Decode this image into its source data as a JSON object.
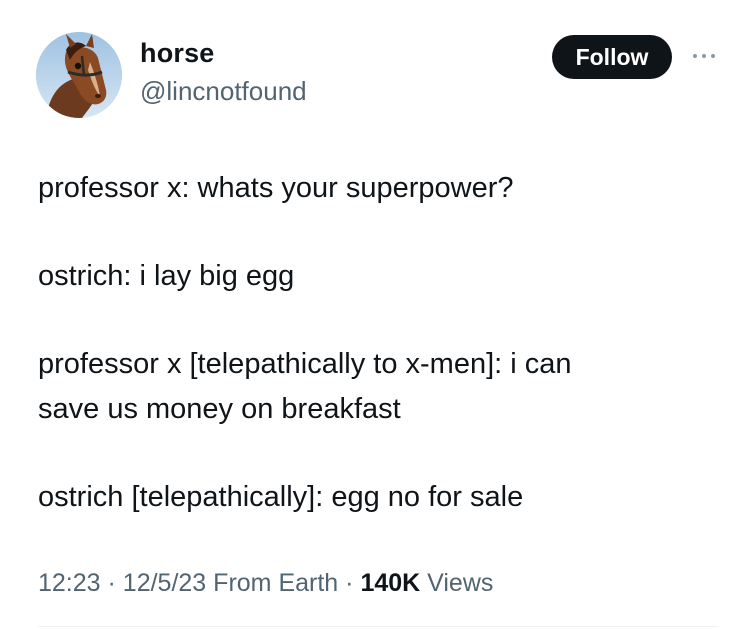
{
  "author": {
    "display_name": "horse",
    "handle": "@lincnotfound",
    "avatar_icon": "horse-avatar-icon"
  },
  "actions": {
    "follow_label": "Follow",
    "more_icon": "more-options-icon"
  },
  "tweet": {
    "lines": [
      "professor x: whats your superpower?",
      "ostrich: i lay big egg",
      "professor x [telepathically to x-men]: i can",
      "save us money on breakfast",
      "ostrich [telepathically]: egg no for sale"
    ]
  },
  "meta": {
    "time": "12:23",
    "date": "12/5/23",
    "source": "From Earth",
    "separator": "·",
    "views_count": "140K",
    "views_label": "Views"
  },
  "colors": {
    "text_primary": "#0f1419",
    "text_secondary": "#536471",
    "follow_bg": "#0f1419",
    "follow_text": "#ffffff"
  }
}
